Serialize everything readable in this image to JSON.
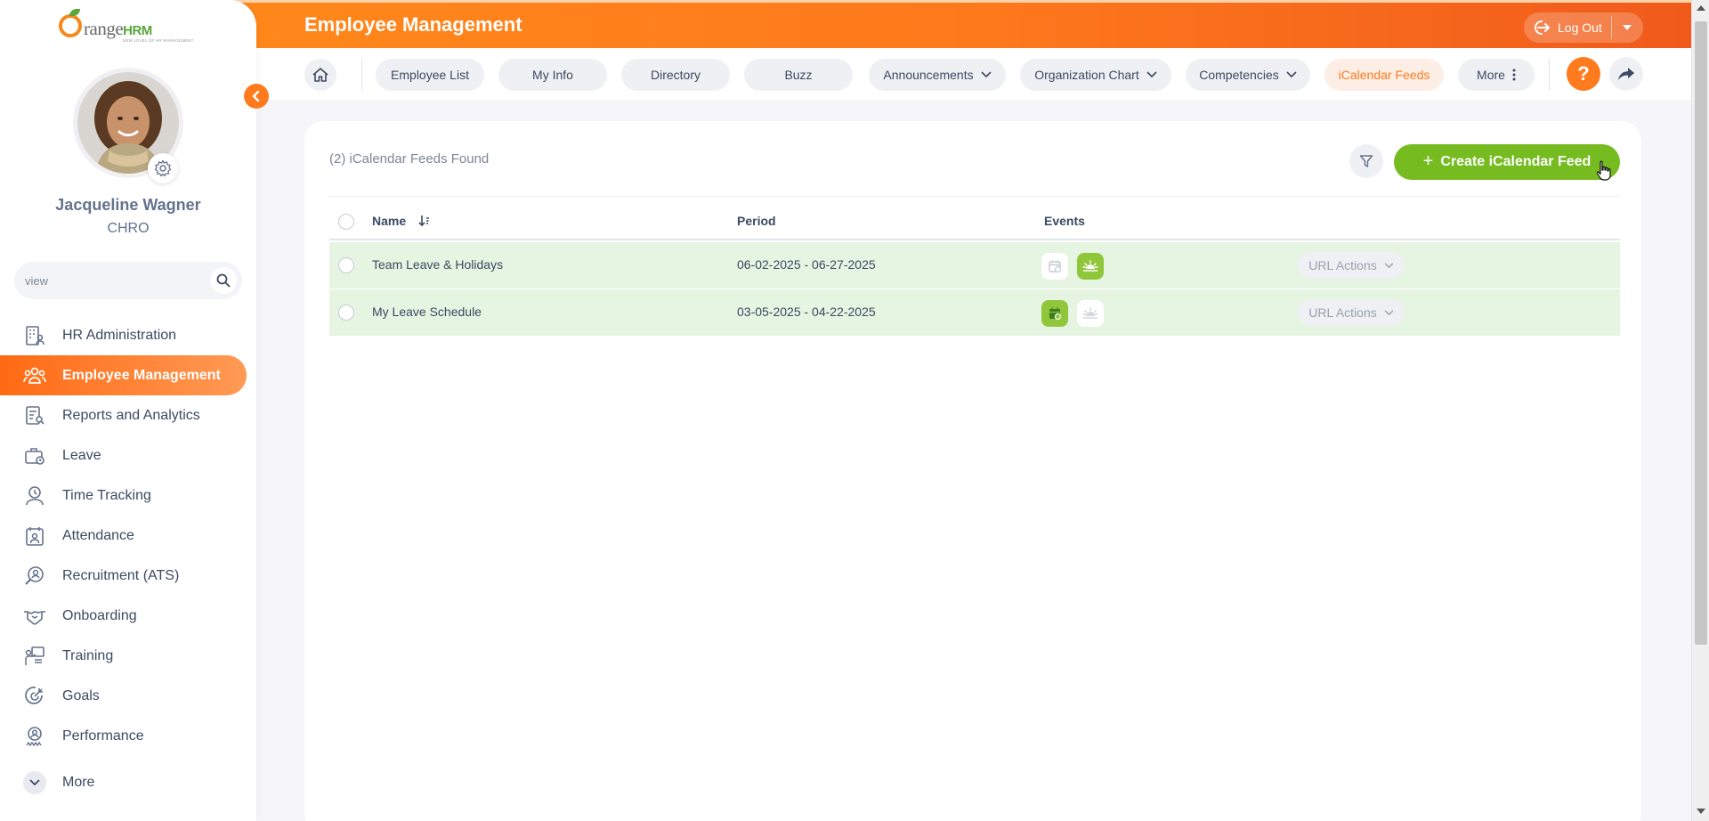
{
  "brand": {
    "name_prefix": "range",
    "name_suffix": "HRM",
    "tagline": "NEW LEVEL OF HR MANAGEMENT"
  },
  "header": {
    "title": "Employee Management",
    "logout_label": "Log Out"
  },
  "user": {
    "name": "Jacqueline Wagner",
    "role": "CHRO"
  },
  "sidebar": {
    "search": {
      "value": "view",
      "placeholder": "Search"
    },
    "items": [
      {
        "label": "HR Administration",
        "icon": "building-person-icon"
      },
      {
        "label": "Employee Management",
        "icon": "people-group-icon",
        "active": true
      },
      {
        "label": "Reports and Analytics",
        "icon": "report-search-icon"
      },
      {
        "label": "Leave",
        "icon": "suitcase-icon"
      },
      {
        "label": "Time Tracking",
        "icon": "clock-person-icon"
      },
      {
        "label": "Attendance",
        "icon": "calendar-person-icon"
      },
      {
        "label": "Recruitment (ATS)",
        "icon": "magnifier-person-icon"
      },
      {
        "label": "Onboarding",
        "icon": "handshake-icon"
      },
      {
        "label": "Training",
        "icon": "presentation-icon"
      },
      {
        "label": "Goals",
        "icon": "target-icon"
      },
      {
        "label": "Performance",
        "icon": "badge-person-icon"
      }
    ],
    "more_label": "More"
  },
  "subnav": {
    "tabs": [
      {
        "label": "Employee List"
      },
      {
        "label": "My Info"
      },
      {
        "label": "Directory"
      },
      {
        "label": "Buzz"
      },
      {
        "label": "Announcements",
        "dropdown": true
      },
      {
        "label": "Organization Chart",
        "dropdown": true
      },
      {
        "label": "Competencies",
        "dropdown": true
      },
      {
        "label": "iCalendar Feeds",
        "active": true
      },
      {
        "label": "More",
        "kebab": true
      }
    ],
    "help_label": "?"
  },
  "main": {
    "records_found": "(2) iCalendar Feeds Found",
    "create_label": "Create iCalendar Feed",
    "columns": {
      "name": "Name",
      "period": "Period",
      "events": "Events"
    },
    "rows": [
      {
        "name": "Team Leave & Holidays",
        "period": "06-02-2025 - 06-27-2025",
        "leave_event": false,
        "holiday_event": true,
        "action_label": "URL Actions"
      },
      {
        "name": "My Leave Schedule",
        "period": "03-05-2025 - 04-22-2025",
        "leave_event": true,
        "holiday_event": false,
        "action_label": "URL Actions"
      }
    ]
  },
  "colors": {
    "accent": "#ff7b1d",
    "create_button": "#76bc21",
    "row_highlight": "#e6f4e2",
    "event_active": "#8fc63a"
  }
}
